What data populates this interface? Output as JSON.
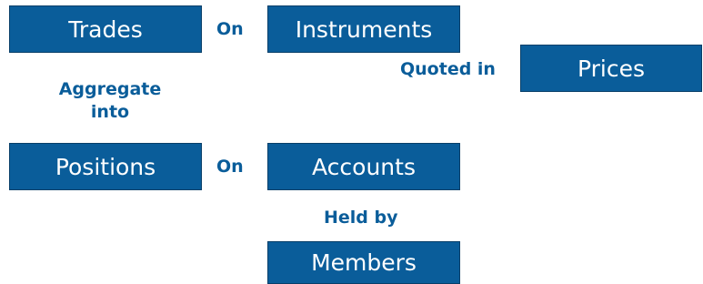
{
  "colors": {
    "box_fill": "#0a5d9a",
    "box_border": "#083f69",
    "box_text": "#ffffff",
    "label_text": "#0a5d9a",
    "background": "#ffffff"
  },
  "boxes": {
    "trades": "Trades",
    "instruments": "Instruments",
    "prices": "Prices",
    "positions": "Positions",
    "accounts": "Accounts",
    "members": "Members"
  },
  "relations": {
    "trades_instruments": "On",
    "instruments_prices": "Quoted in",
    "trades_positions_line1": "Aggregate",
    "trades_positions_line2": "into",
    "positions_accounts": "On",
    "accounts_members": "Held by"
  }
}
